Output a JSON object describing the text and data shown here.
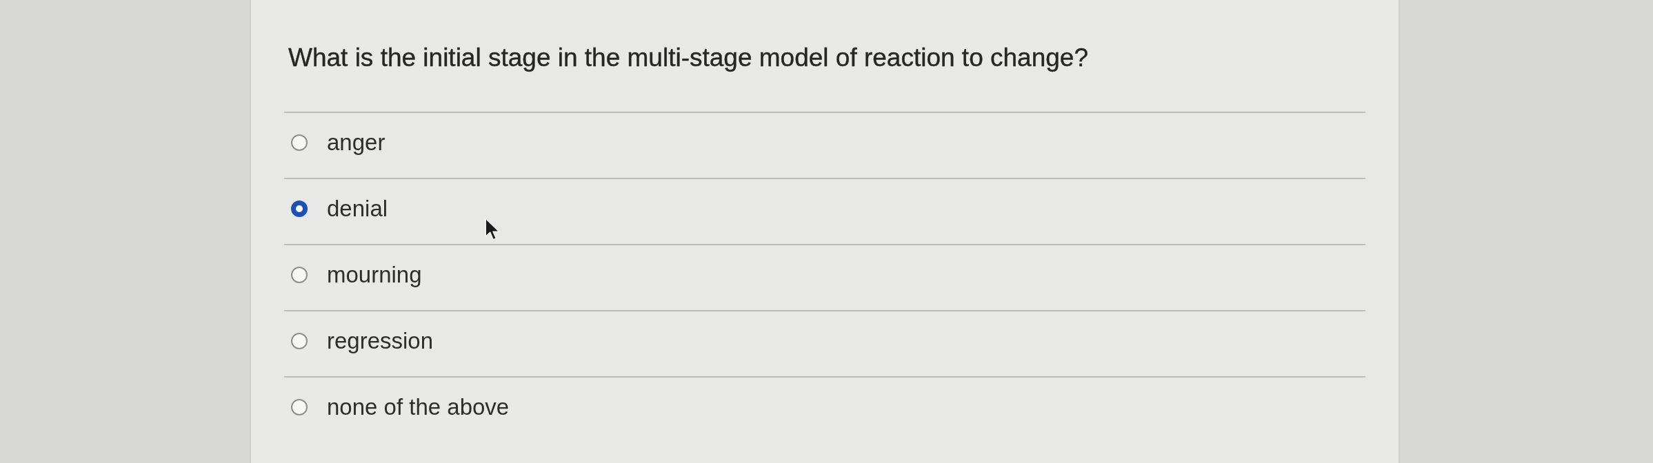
{
  "question": {
    "text": "What is the initial stage in the multi-stage model of reaction to change?"
  },
  "options": [
    {
      "label": "anger",
      "selected": false
    },
    {
      "label": "denial",
      "selected": true
    },
    {
      "label": "mourning",
      "selected": false
    },
    {
      "label": "regression",
      "selected": false
    },
    {
      "label": "none of the above",
      "selected": false
    }
  ]
}
